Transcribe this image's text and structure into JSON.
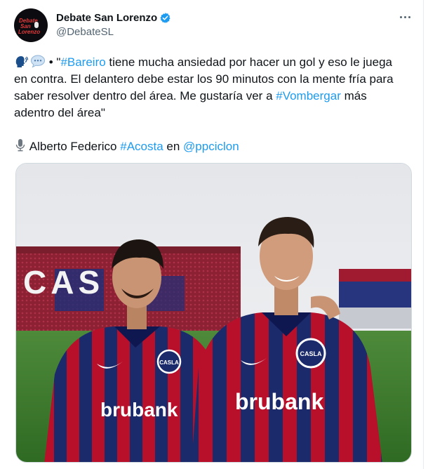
{
  "account": {
    "display_name": "Debate San Lorenzo",
    "handle": "@DebateSL",
    "avatar_logo_lines": [
      "Debate",
      "San",
      "Lorenzo"
    ]
  },
  "tweet": {
    "line1": {
      "sep": " • \"",
      "tag": "#Bareiro",
      "rest": " tiene mucha ansiedad por hacer un gol y eso le juega"
    },
    "line2": "en contra. El delantero debe estar los 90 minutos con la mente fría para",
    "line3": {
      "pre": "saber resolver dentro del área. Me gustaría ver a ",
      "tag": "#Vombergar",
      "post": " más"
    },
    "line4": "adentro del área\"",
    "line5": {
      "name": " Alberto Federico ",
      "tag": "#Acosta",
      "mid": " en ",
      "mention": "@ppciclon"
    }
  },
  "photo": {
    "stadium_letters": "CAS",
    "jersey_text_left": "brubank",
    "jersey_text_right": "brubank",
    "crest_text": "CASLA"
  },
  "colors": {
    "link": "#1d9bf0",
    "verified": "#1d9bf0",
    "club_red": "#b8102b",
    "club_blue": "#1b2a6b"
  },
  "icons": [
    "verified-badge-icon",
    "more-options-icon",
    "speaking-head-icon",
    "speech-bubble-icon",
    "microphone-icon"
  ]
}
